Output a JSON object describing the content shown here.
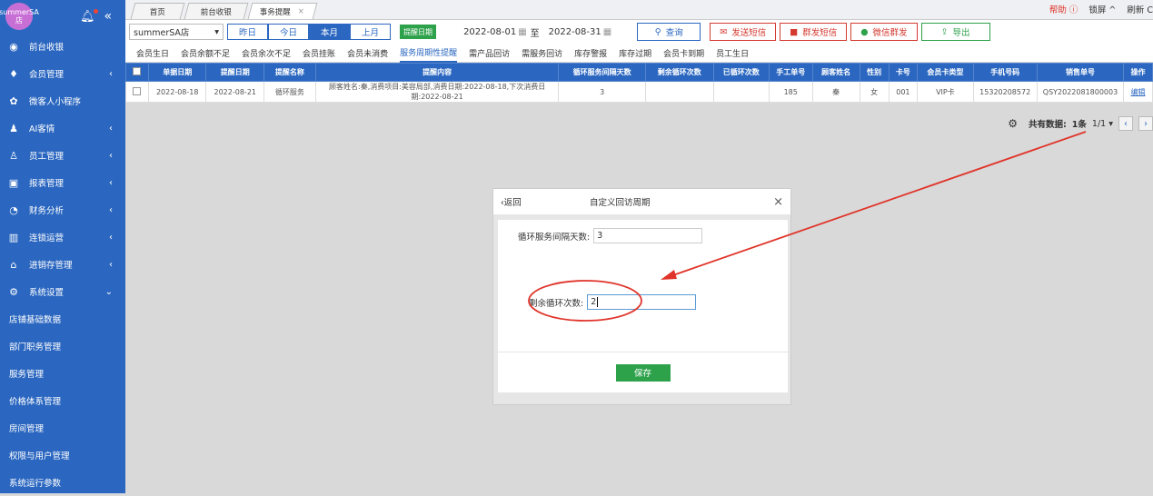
{
  "sidebar": {
    "logo_text": "summerSA店",
    "items": [
      {
        "label": "前台收银",
        "icon": "cashier-icon",
        "arrow": ""
      },
      {
        "label": "会员管理",
        "icon": "diamond-icon",
        "arrow": "‹"
      },
      {
        "label": "微客人小程序",
        "icon": "miniapp-icon",
        "arrow": ""
      },
      {
        "label": "AI客情",
        "icon": "people-icon",
        "arrow": "‹"
      },
      {
        "label": "员工管理",
        "icon": "user-icon",
        "arrow": "‹"
      },
      {
        "label": "报表管理",
        "icon": "monitor-icon",
        "arrow": "‹"
      },
      {
        "label": "财务分析",
        "icon": "piechart-icon",
        "arrow": "‹"
      },
      {
        "label": "连锁运营",
        "icon": "building-icon",
        "arrow": "‹"
      },
      {
        "label": "进销存管理",
        "icon": "home-icon",
        "arrow": "‹"
      },
      {
        "label": "系统设置",
        "icon": "gear-icon",
        "arrow": "⌄"
      }
    ],
    "subitems": [
      "店铺基础数据",
      "部门职务管理",
      "服务管理",
      "价格体系管理",
      "房间管理",
      "权限与用户管理",
      "系统运行参数"
    ]
  },
  "tabs": [
    {
      "label": "首页"
    },
    {
      "label": "前台收银"
    },
    {
      "label": "事务提醒",
      "close": "×"
    }
  ],
  "topright": {
    "help": "帮助 ⓘ",
    "lock": "锁屏 ^",
    "refresh": "刷新 C"
  },
  "toolbar": {
    "store": "summerSA店",
    "periods": [
      "昨日",
      "今日",
      "本月",
      "上月"
    ],
    "date_badge": "提醒日期",
    "date_from": "2022-08-01",
    "date_sep": "至",
    "date_to": "2022-08-31",
    "query": "查询",
    "send_sms": "发送短信",
    "group_sms": "群发短信",
    "wechat_group": "微信群发",
    "export": "导出"
  },
  "subtabs": [
    "会员生日",
    "会员余额不足",
    "会员余次不足",
    "会员挂账",
    "会员未消费",
    "服务周期性提醒",
    "需产品回访",
    "需服务回访",
    "库存警报",
    "库存过期",
    "会员卡到期",
    "员工生日"
  ],
  "table": {
    "headers": [
      "单据日期",
      "提醒日期",
      "提醒名称",
      "提醒内容",
      "循环服务间隔天数",
      "剩余循环次数",
      "已循环次数",
      "手工单号",
      "顾客姓名",
      "性别",
      "卡号",
      "会员卡类型",
      "手机号码",
      "销售单号",
      "操作"
    ],
    "rows": [
      [
        "2022-08-18",
        "2022-08-21",
        "循环服务",
        "顾客姓名:秦,消费项目:美容局部,消费日期:2022-08-18,下次消费日期:2022-08-21",
        "3",
        "",
        "",
        "185",
        "秦",
        "女",
        "001",
        "VIP卡",
        "15320208572",
        "QSY2022081800003",
        "编辑"
      ]
    ]
  },
  "pager": {
    "total_label": "共有数据:",
    "total": "1条",
    "page": "1/1"
  },
  "modal": {
    "back": "‹返回",
    "title": "自定义回访周期",
    "close": "×",
    "interval_label": "循环服务间隔天数:",
    "interval_value": "3",
    "remaining_label": "剩余循环次数:",
    "remaining_value": "2",
    "save": "保存"
  },
  "colors": {
    "sidebar": "#2b67c0",
    "annotation": "#e0342a",
    "save": "#2ea24b"
  }
}
